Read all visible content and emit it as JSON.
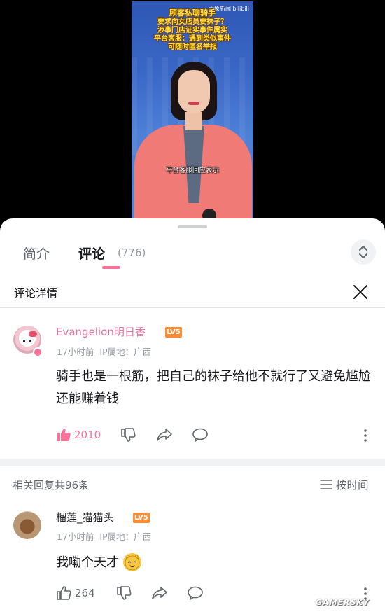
{
  "video": {
    "watermark": "大象新闻 bilibili",
    "headline": [
      "顾客私聊骑手",
      "要求向女店员要袜子？",
      "涉事门店证实事件属实",
      "平台客服：遇到类似事件",
      "可随时匿名举报"
    ],
    "subtitle": "平台客服回应表示"
  },
  "tabs": {
    "intro": "简介",
    "comments": "评论",
    "comment_count": "(776)"
  },
  "detail": {
    "title": "评论详情"
  },
  "main_comment": {
    "username": "Evangelion明日香",
    "level": "LV5",
    "time": "17小时前",
    "ip_location": "IP属地：广西",
    "text": "骑手也是一根筋，把自己的袜子给他不就行了又避免尴尬还能赚着钱",
    "likes": "2010"
  },
  "replies_header": {
    "label": "相关回复共96条",
    "sort": "按时间"
  },
  "reply": {
    "username": "榴莲_猫猫头",
    "level": "LV5",
    "time": "17小时前",
    "ip_location": "IP属地：广西",
    "text": "我嘞个天才",
    "emoji": "cat-face-emoji",
    "likes": "264"
  },
  "site_watermark": "GAMERSKY",
  "colors": {
    "accent": "#fb7299",
    "level_badge": "#ff8c32",
    "vip_name": "#e5749c"
  }
}
